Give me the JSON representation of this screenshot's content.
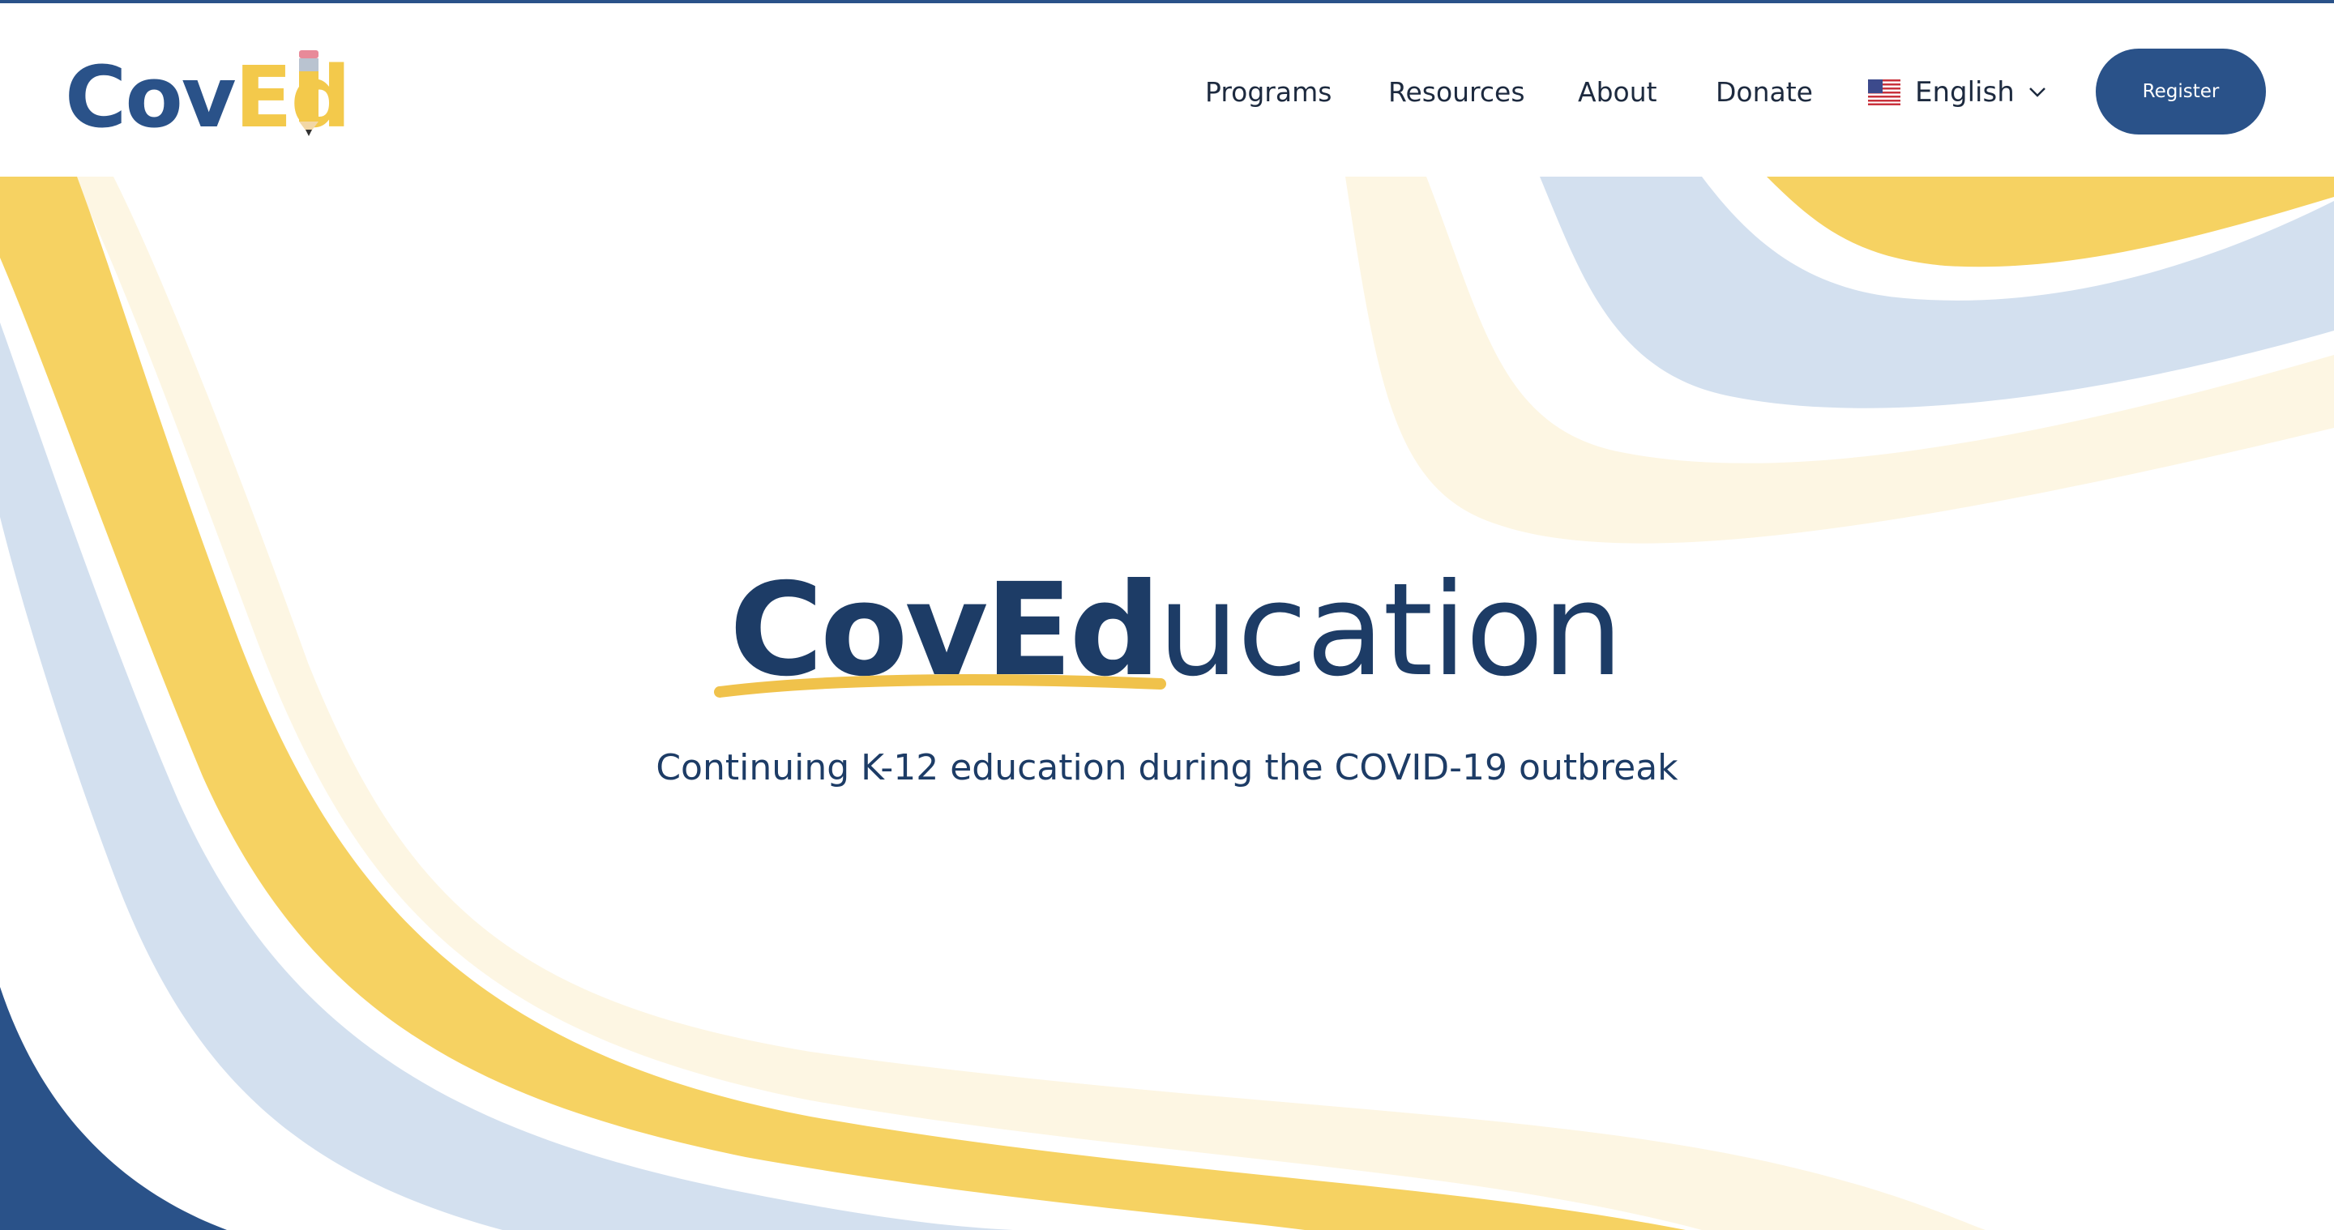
{
  "logo": {
    "part1": "Cov",
    "part2": "Ed"
  },
  "nav": {
    "items": [
      {
        "label": "Programs"
      },
      {
        "label": "Resources"
      },
      {
        "label": "About"
      },
      {
        "label": "Donate"
      }
    ],
    "language": {
      "label": "English",
      "flag_icon": "us-flag-icon"
    },
    "register_label": "Register"
  },
  "hero": {
    "title_bold": "CovEd",
    "title_light": "ucation",
    "subtitle": "Continuing K-12 education during the COVID-19 outbreak"
  },
  "colors": {
    "navy": "#1d3c66",
    "brand_blue": "#2a5289",
    "yellow": "#f3c94b",
    "light_blue": "#d3e0ef",
    "cream": "#fdf6e3"
  }
}
